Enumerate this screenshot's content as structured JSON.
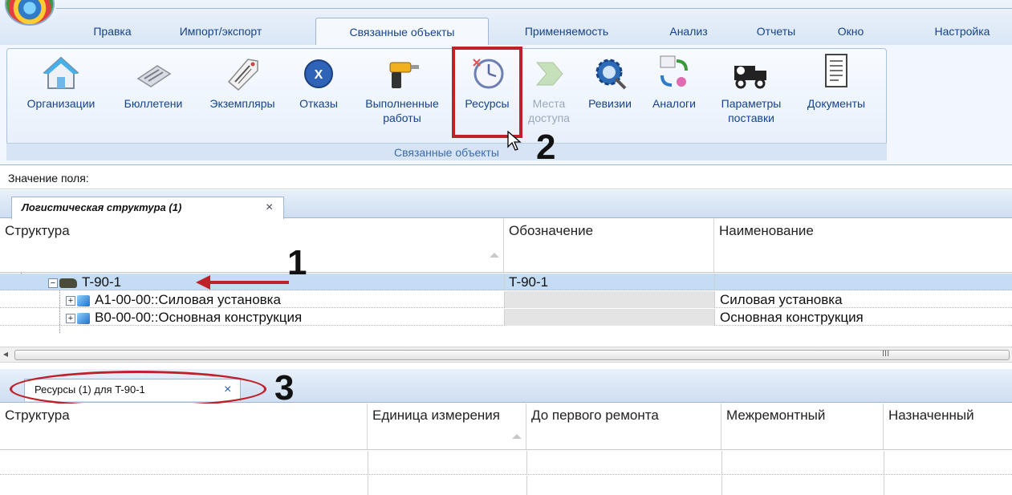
{
  "ribbon": {
    "tabs": [
      {
        "label": "Правка"
      },
      {
        "label": "Импорт/экспорт"
      },
      {
        "label": "Связанные объекты"
      },
      {
        "label": "Применяемость"
      },
      {
        "label": "Анализ"
      },
      {
        "label": "Отчеты"
      },
      {
        "label": "Окно"
      },
      {
        "label": "Настройка"
      }
    ],
    "active_tab": "Связанные объекты",
    "group_caption": "Связанные объекты",
    "buttons": [
      {
        "label": "Организации",
        "icon": "house-icon"
      },
      {
        "label": "Бюллетени",
        "icon": "newspaper-icon"
      },
      {
        "label": "Экземпляры",
        "icon": "tag-icon"
      },
      {
        "label": "Отказы",
        "icon": "x-circle-icon"
      },
      {
        "label": "Выполненные",
        "label2": "работы",
        "icon": "drill-icon"
      },
      {
        "label": "Ресурсы",
        "icon": "clock-icon"
      },
      {
        "label": "Места",
        "label2": "доступа",
        "icon": "access-icon"
      },
      {
        "label": "Ревизии",
        "icon": "gear-magnifier-icon"
      },
      {
        "label": "Аналоги",
        "icon": "analogs-icon"
      },
      {
        "label": "Параметры",
        "label2": "поставки",
        "icon": "delivery-truck-icon"
      },
      {
        "label": "Документы",
        "icon": "document-icon"
      }
    ]
  },
  "field_value_label": "Значение поля:",
  "top_panel": {
    "tab_label": "Логистическая структура (1)",
    "columns": [
      "Структура",
      "Обозначение",
      "Наименование"
    ],
    "rows": [
      {
        "structure": "T-90-1",
        "designation": "T-90-1",
        "name": ""
      },
      {
        "structure": "A1-00-00::Силовая установка",
        "designation": "",
        "name": "Силовая установка"
      },
      {
        "structure": "B0-00-00::Основная конструкция",
        "designation": "",
        "name": "Основная конструкция"
      }
    ]
  },
  "bottom_panel": {
    "tab_label": "Ресурсы (1) для T-90-1",
    "columns": [
      "Структура",
      "Единица измерения",
      "До первого ремонта",
      "Межремонтный",
      "Назначенный"
    ]
  },
  "annotations": {
    "n1": "1",
    "n2": "2",
    "n3": "3"
  },
  "colors": {
    "highlight": "#c0202a",
    "selection": "#c5dcf5",
    "ribbon_text": "#15428b"
  }
}
